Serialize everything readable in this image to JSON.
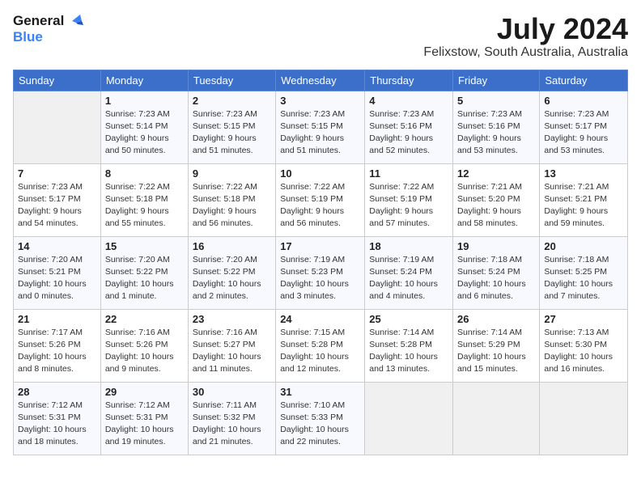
{
  "header": {
    "logo_line1": "General",
    "logo_line2": "Blue",
    "month": "July 2024",
    "location": "Felixstow, South Australia, Australia"
  },
  "days_of_week": [
    "Sunday",
    "Monday",
    "Tuesday",
    "Wednesday",
    "Thursday",
    "Friday",
    "Saturday"
  ],
  "weeks": [
    [
      {
        "day": "",
        "info": ""
      },
      {
        "day": "1",
        "info": "Sunrise: 7:23 AM\nSunset: 5:14 PM\nDaylight: 9 hours\nand 50 minutes."
      },
      {
        "day": "2",
        "info": "Sunrise: 7:23 AM\nSunset: 5:15 PM\nDaylight: 9 hours\nand 51 minutes."
      },
      {
        "day": "3",
        "info": "Sunrise: 7:23 AM\nSunset: 5:15 PM\nDaylight: 9 hours\nand 51 minutes."
      },
      {
        "day": "4",
        "info": "Sunrise: 7:23 AM\nSunset: 5:16 PM\nDaylight: 9 hours\nand 52 minutes."
      },
      {
        "day": "5",
        "info": "Sunrise: 7:23 AM\nSunset: 5:16 PM\nDaylight: 9 hours\nand 53 minutes."
      },
      {
        "day": "6",
        "info": "Sunrise: 7:23 AM\nSunset: 5:17 PM\nDaylight: 9 hours\nand 53 minutes."
      }
    ],
    [
      {
        "day": "7",
        "info": "Sunrise: 7:23 AM\nSunset: 5:17 PM\nDaylight: 9 hours\nand 54 minutes."
      },
      {
        "day": "8",
        "info": "Sunrise: 7:22 AM\nSunset: 5:18 PM\nDaylight: 9 hours\nand 55 minutes."
      },
      {
        "day": "9",
        "info": "Sunrise: 7:22 AM\nSunset: 5:18 PM\nDaylight: 9 hours\nand 56 minutes."
      },
      {
        "day": "10",
        "info": "Sunrise: 7:22 AM\nSunset: 5:19 PM\nDaylight: 9 hours\nand 56 minutes."
      },
      {
        "day": "11",
        "info": "Sunrise: 7:22 AM\nSunset: 5:19 PM\nDaylight: 9 hours\nand 57 minutes."
      },
      {
        "day": "12",
        "info": "Sunrise: 7:21 AM\nSunset: 5:20 PM\nDaylight: 9 hours\nand 58 minutes."
      },
      {
        "day": "13",
        "info": "Sunrise: 7:21 AM\nSunset: 5:21 PM\nDaylight: 9 hours\nand 59 minutes."
      }
    ],
    [
      {
        "day": "14",
        "info": "Sunrise: 7:20 AM\nSunset: 5:21 PM\nDaylight: 10 hours\nand 0 minutes."
      },
      {
        "day": "15",
        "info": "Sunrise: 7:20 AM\nSunset: 5:22 PM\nDaylight: 10 hours\nand 1 minute."
      },
      {
        "day": "16",
        "info": "Sunrise: 7:20 AM\nSunset: 5:22 PM\nDaylight: 10 hours\nand 2 minutes."
      },
      {
        "day": "17",
        "info": "Sunrise: 7:19 AM\nSunset: 5:23 PM\nDaylight: 10 hours\nand 3 minutes."
      },
      {
        "day": "18",
        "info": "Sunrise: 7:19 AM\nSunset: 5:24 PM\nDaylight: 10 hours\nand 4 minutes."
      },
      {
        "day": "19",
        "info": "Sunrise: 7:18 AM\nSunset: 5:24 PM\nDaylight: 10 hours\nand 6 minutes."
      },
      {
        "day": "20",
        "info": "Sunrise: 7:18 AM\nSunset: 5:25 PM\nDaylight: 10 hours\nand 7 minutes."
      }
    ],
    [
      {
        "day": "21",
        "info": "Sunrise: 7:17 AM\nSunset: 5:26 PM\nDaylight: 10 hours\nand 8 minutes."
      },
      {
        "day": "22",
        "info": "Sunrise: 7:16 AM\nSunset: 5:26 PM\nDaylight: 10 hours\nand 9 minutes."
      },
      {
        "day": "23",
        "info": "Sunrise: 7:16 AM\nSunset: 5:27 PM\nDaylight: 10 hours\nand 11 minutes."
      },
      {
        "day": "24",
        "info": "Sunrise: 7:15 AM\nSunset: 5:28 PM\nDaylight: 10 hours\nand 12 minutes."
      },
      {
        "day": "25",
        "info": "Sunrise: 7:14 AM\nSunset: 5:28 PM\nDaylight: 10 hours\nand 13 minutes."
      },
      {
        "day": "26",
        "info": "Sunrise: 7:14 AM\nSunset: 5:29 PM\nDaylight: 10 hours\nand 15 minutes."
      },
      {
        "day": "27",
        "info": "Sunrise: 7:13 AM\nSunset: 5:30 PM\nDaylight: 10 hours\nand 16 minutes."
      }
    ],
    [
      {
        "day": "28",
        "info": "Sunrise: 7:12 AM\nSunset: 5:31 PM\nDaylight: 10 hours\nand 18 minutes."
      },
      {
        "day": "29",
        "info": "Sunrise: 7:12 AM\nSunset: 5:31 PM\nDaylight: 10 hours\nand 19 minutes."
      },
      {
        "day": "30",
        "info": "Sunrise: 7:11 AM\nSunset: 5:32 PM\nDaylight: 10 hours\nand 21 minutes."
      },
      {
        "day": "31",
        "info": "Sunrise: 7:10 AM\nSunset: 5:33 PM\nDaylight: 10 hours\nand 22 minutes."
      },
      {
        "day": "",
        "info": ""
      },
      {
        "day": "",
        "info": ""
      },
      {
        "day": "",
        "info": ""
      }
    ]
  ]
}
